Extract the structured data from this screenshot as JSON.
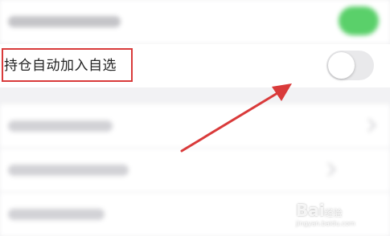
{
  "setting_row": {
    "label": "持仓自动加入自选",
    "toggle_state": "off"
  },
  "colors": {
    "highlight": "#d93a3a",
    "arrow": "#d93a3a",
    "toggle_on": "#5ad06a",
    "toggle_off": "#e9e9eb"
  },
  "watermark": {
    "brand": "Bai",
    "suffix": "经验",
    "site": "jingyan.baidu.com"
  }
}
